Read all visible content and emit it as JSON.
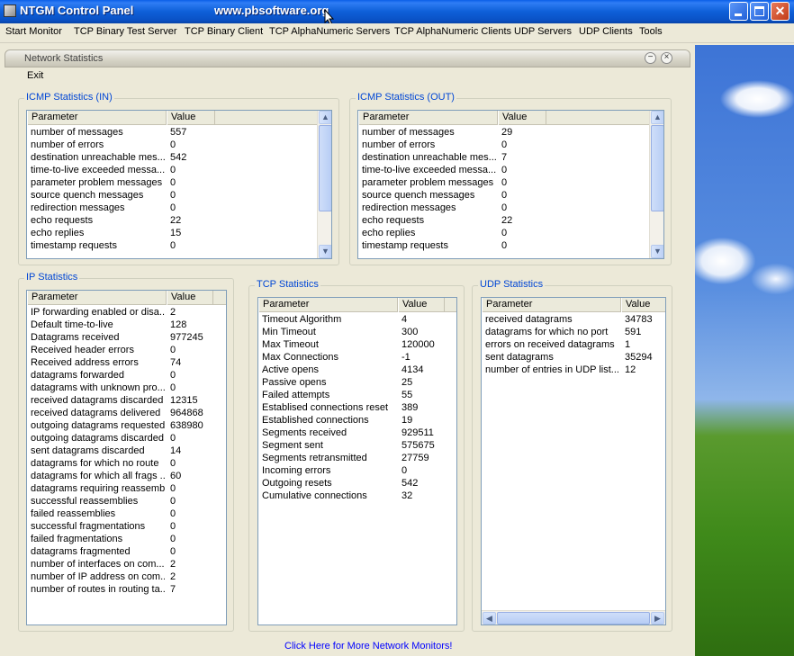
{
  "window": {
    "title": "NTGM Control Panel",
    "url_text": "www.pbsoftware.org"
  },
  "menu": [
    "Start Monitor",
    "TCP Binary Test Server",
    "TCP Binary Client",
    "TCP AlphaNumeric Servers",
    "TCP AlphaNumeric Clients",
    "UDP Servers",
    "UDP Clients",
    "Tools"
  ],
  "child": {
    "title": "Network Statistics",
    "exit_label": "Exit",
    "more_link": "Click Here for More Network Monitors!"
  },
  "columns": {
    "param": "Parameter",
    "value": "Value"
  },
  "icmp_in": {
    "label": "ICMP Statistics (IN)",
    "rows": [
      [
        "number of messages",
        "557"
      ],
      [
        "number of errors",
        "0"
      ],
      [
        "destination unreachable mes...",
        "542"
      ],
      [
        "time-to-live exceeded messa...",
        "0"
      ],
      [
        "parameter problem messages",
        "0"
      ],
      [
        "source quench messages",
        "0"
      ],
      [
        "redirection messages",
        "0"
      ],
      [
        "echo requests",
        "22"
      ],
      [
        "echo replies",
        "15"
      ],
      [
        "timestamp requests",
        "0"
      ]
    ]
  },
  "icmp_out": {
    "label": "ICMP Statistics (OUT)",
    "rows": [
      [
        "number of messages",
        "29"
      ],
      [
        "number of errors",
        "0"
      ],
      [
        "destination unreachable mes...",
        "7"
      ],
      [
        "time-to-live exceeded messa...",
        "0"
      ],
      [
        "parameter problem messages",
        "0"
      ],
      [
        "source quench messages",
        "0"
      ],
      [
        "redirection messages",
        "0"
      ],
      [
        "echo requests",
        "22"
      ],
      [
        "echo replies",
        "0"
      ],
      [
        "timestamp requests",
        "0"
      ]
    ]
  },
  "ip": {
    "label": "IP Statistics",
    "rows": [
      [
        "IP forwarding enabled or disa...",
        "2"
      ],
      [
        "Default time-to-live",
        "128"
      ],
      [
        "Datagrams received",
        "977245"
      ],
      [
        "Received header errors",
        "0"
      ],
      [
        "Received address errors",
        "74"
      ],
      [
        "datagrams forwarded",
        "0"
      ],
      [
        "datagrams with unknown pro...",
        "0"
      ],
      [
        "received datagrams discarded",
        "12315"
      ],
      [
        "received datagrams delivered",
        "964868"
      ],
      [
        "outgoing datagrams requested",
        "638980"
      ],
      [
        "outgoing datagrams discarded",
        "0"
      ],
      [
        "sent datagrams discarded",
        "14"
      ],
      [
        "datagrams for which no route",
        "0"
      ],
      [
        "datagrams for which all frags ...",
        "60"
      ],
      [
        "datagrams requiring reassembly",
        "0"
      ],
      [
        "successful reassemblies",
        "0"
      ],
      [
        "failed reassemblies",
        "0"
      ],
      [
        "successful fragmentations",
        "0"
      ],
      [
        "failed fragmentations",
        "0"
      ],
      [
        "datagrams fragmented",
        "0"
      ],
      [
        "number of interfaces on com...",
        "2"
      ],
      [
        "number of IP address on com...",
        "2"
      ],
      [
        "number of routes in routing ta...",
        "7"
      ]
    ]
  },
  "tcp": {
    "label": "TCP Statistics",
    "rows": [
      [
        "Timeout Algorithm",
        "4"
      ],
      [
        "Min Timeout",
        "300"
      ],
      [
        "Max Timeout",
        "120000"
      ],
      [
        "Max Connections",
        "-1"
      ],
      [
        "Active opens",
        "4134"
      ],
      [
        "Passive opens",
        "25"
      ],
      [
        "Failed attempts",
        "55"
      ],
      [
        "Establised connections reset",
        "389"
      ],
      [
        "Established connections",
        "19"
      ],
      [
        "Segments received",
        "929511"
      ],
      [
        "Segment sent",
        "575675"
      ],
      [
        "Segments retransmitted",
        "27759"
      ],
      [
        "Incoming errors",
        "0"
      ],
      [
        "Outgoing resets",
        "542"
      ],
      [
        "Cumulative connections",
        "32"
      ]
    ]
  },
  "udp": {
    "label": "UDP Statistics",
    "rows": [
      [
        "received datagrams",
        "34783"
      ],
      [
        "datagrams for which no port",
        "591"
      ],
      [
        "errors on received datagrams",
        "1"
      ],
      [
        "sent datagrams",
        "35294"
      ],
      [
        "number of entries in UDP list...",
        "12"
      ]
    ]
  }
}
